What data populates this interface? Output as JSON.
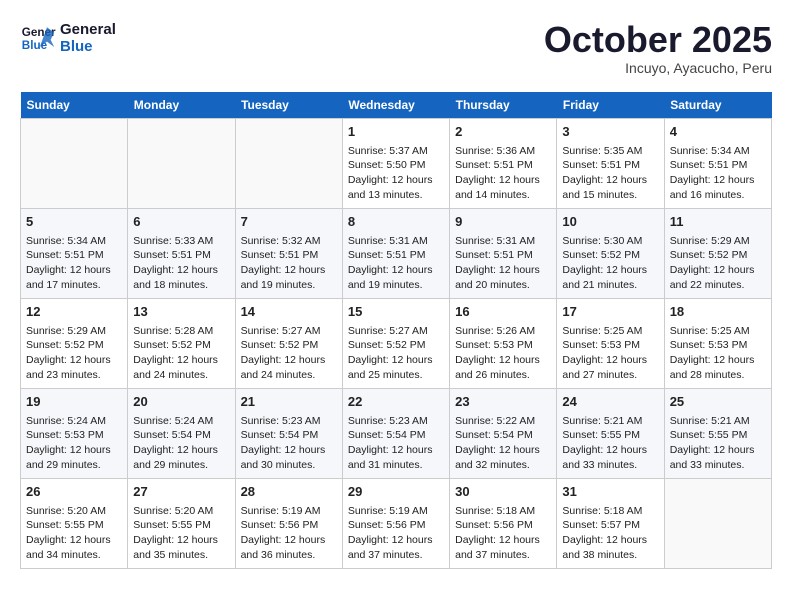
{
  "header": {
    "logo_line1": "General",
    "logo_line2": "Blue",
    "month": "October 2025",
    "location": "Incuyo, Ayacucho, Peru"
  },
  "weekdays": [
    "Sunday",
    "Monday",
    "Tuesday",
    "Wednesday",
    "Thursday",
    "Friday",
    "Saturday"
  ],
  "weeks": [
    [
      {
        "day": "",
        "info": ""
      },
      {
        "day": "",
        "info": ""
      },
      {
        "day": "",
        "info": ""
      },
      {
        "day": "1",
        "info": "Sunrise: 5:37 AM\nSunset: 5:50 PM\nDaylight: 12 hours\nand 13 minutes."
      },
      {
        "day": "2",
        "info": "Sunrise: 5:36 AM\nSunset: 5:51 PM\nDaylight: 12 hours\nand 14 minutes."
      },
      {
        "day": "3",
        "info": "Sunrise: 5:35 AM\nSunset: 5:51 PM\nDaylight: 12 hours\nand 15 minutes."
      },
      {
        "day": "4",
        "info": "Sunrise: 5:34 AM\nSunset: 5:51 PM\nDaylight: 12 hours\nand 16 minutes."
      }
    ],
    [
      {
        "day": "5",
        "info": "Sunrise: 5:34 AM\nSunset: 5:51 PM\nDaylight: 12 hours\nand 17 minutes."
      },
      {
        "day": "6",
        "info": "Sunrise: 5:33 AM\nSunset: 5:51 PM\nDaylight: 12 hours\nand 18 minutes."
      },
      {
        "day": "7",
        "info": "Sunrise: 5:32 AM\nSunset: 5:51 PM\nDaylight: 12 hours\nand 19 minutes."
      },
      {
        "day": "8",
        "info": "Sunrise: 5:31 AM\nSunset: 5:51 PM\nDaylight: 12 hours\nand 19 minutes."
      },
      {
        "day": "9",
        "info": "Sunrise: 5:31 AM\nSunset: 5:51 PM\nDaylight: 12 hours\nand 20 minutes."
      },
      {
        "day": "10",
        "info": "Sunrise: 5:30 AM\nSunset: 5:52 PM\nDaylight: 12 hours\nand 21 minutes."
      },
      {
        "day": "11",
        "info": "Sunrise: 5:29 AM\nSunset: 5:52 PM\nDaylight: 12 hours\nand 22 minutes."
      }
    ],
    [
      {
        "day": "12",
        "info": "Sunrise: 5:29 AM\nSunset: 5:52 PM\nDaylight: 12 hours\nand 23 minutes."
      },
      {
        "day": "13",
        "info": "Sunrise: 5:28 AM\nSunset: 5:52 PM\nDaylight: 12 hours\nand 24 minutes."
      },
      {
        "day": "14",
        "info": "Sunrise: 5:27 AM\nSunset: 5:52 PM\nDaylight: 12 hours\nand 24 minutes."
      },
      {
        "day": "15",
        "info": "Sunrise: 5:27 AM\nSunset: 5:52 PM\nDaylight: 12 hours\nand 25 minutes."
      },
      {
        "day": "16",
        "info": "Sunrise: 5:26 AM\nSunset: 5:53 PM\nDaylight: 12 hours\nand 26 minutes."
      },
      {
        "day": "17",
        "info": "Sunrise: 5:25 AM\nSunset: 5:53 PM\nDaylight: 12 hours\nand 27 minutes."
      },
      {
        "day": "18",
        "info": "Sunrise: 5:25 AM\nSunset: 5:53 PM\nDaylight: 12 hours\nand 28 minutes."
      }
    ],
    [
      {
        "day": "19",
        "info": "Sunrise: 5:24 AM\nSunset: 5:53 PM\nDaylight: 12 hours\nand 29 minutes."
      },
      {
        "day": "20",
        "info": "Sunrise: 5:24 AM\nSunset: 5:54 PM\nDaylight: 12 hours\nand 29 minutes."
      },
      {
        "day": "21",
        "info": "Sunrise: 5:23 AM\nSunset: 5:54 PM\nDaylight: 12 hours\nand 30 minutes."
      },
      {
        "day": "22",
        "info": "Sunrise: 5:23 AM\nSunset: 5:54 PM\nDaylight: 12 hours\nand 31 minutes."
      },
      {
        "day": "23",
        "info": "Sunrise: 5:22 AM\nSunset: 5:54 PM\nDaylight: 12 hours\nand 32 minutes."
      },
      {
        "day": "24",
        "info": "Sunrise: 5:21 AM\nSunset: 5:55 PM\nDaylight: 12 hours\nand 33 minutes."
      },
      {
        "day": "25",
        "info": "Sunrise: 5:21 AM\nSunset: 5:55 PM\nDaylight: 12 hours\nand 33 minutes."
      }
    ],
    [
      {
        "day": "26",
        "info": "Sunrise: 5:20 AM\nSunset: 5:55 PM\nDaylight: 12 hours\nand 34 minutes."
      },
      {
        "day": "27",
        "info": "Sunrise: 5:20 AM\nSunset: 5:55 PM\nDaylight: 12 hours\nand 35 minutes."
      },
      {
        "day": "28",
        "info": "Sunrise: 5:19 AM\nSunset: 5:56 PM\nDaylight: 12 hours\nand 36 minutes."
      },
      {
        "day": "29",
        "info": "Sunrise: 5:19 AM\nSunset: 5:56 PM\nDaylight: 12 hours\nand 37 minutes."
      },
      {
        "day": "30",
        "info": "Sunrise: 5:18 AM\nSunset: 5:56 PM\nDaylight: 12 hours\nand 37 minutes."
      },
      {
        "day": "31",
        "info": "Sunrise: 5:18 AM\nSunset: 5:57 PM\nDaylight: 12 hours\nand 38 minutes."
      },
      {
        "day": "",
        "info": ""
      }
    ]
  ]
}
